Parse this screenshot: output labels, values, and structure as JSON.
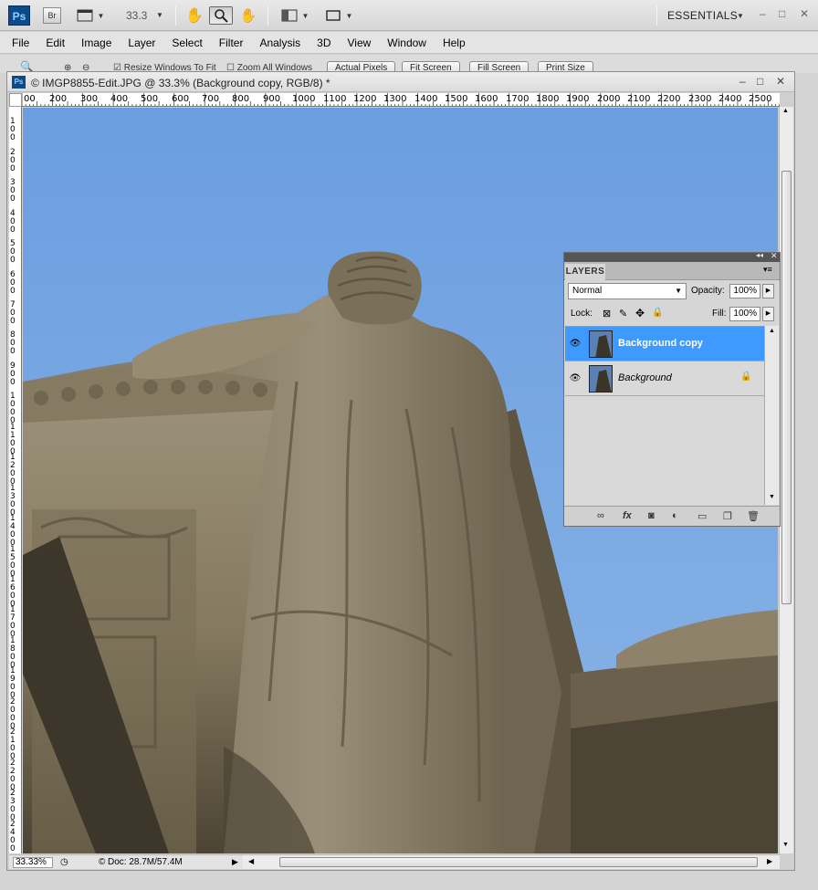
{
  "app": {
    "logo": "Ps",
    "bridge": "Br",
    "zoom": "33.3",
    "workspace": "ESSENTIALS"
  },
  "menu": [
    "File",
    "Edit",
    "Image",
    "Layer",
    "Select",
    "Filter",
    "Analysis",
    "3D",
    "View",
    "Window",
    "Help"
  ],
  "options": {
    "resize_windows": "Resize Windows To Fit",
    "zoom_all": "Zoom All Windows",
    "actual_pixels": "Actual Pixels",
    "fit_screen": "Fit Screen",
    "fill_screen": "Fill Screen",
    "print_size": "Print Size"
  },
  "document": {
    "title": "© IMGP8855-Edit.JPG @ 33.3% (Background copy, RGB/8) *",
    "ruler_top": [
      "00",
      "200",
      "300",
      "400",
      "500",
      "600",
      "700",
      "800",
      "900",
      "1000",
      "1100",
      "1200",
      "1300",
      "1400",
      "1500",
      "1600",
      "1700",
      "1800",
      "1900",
      "2000",
      "2100",
      "2200",
      "2300",
      "2400",
      "2500"
    ],
    "ruler_left": [
      "1 0 0",
      "2 0 0",
      "3 0 0",
      "4 0 0",
      "5 0 0",
      "6 0 0",
      "7 0 0",
      "8 0 0",
      "9 0 0",
      "1 0 0 0",
      "1 1 0 0",
      "1 2 0 0",
      "1 3 0 0",
      "1 4 0 0",
      "1 5 0 0",
      "1 6 0 0",
      "1 7 0 0",
      "1 8 0 0",
      "1 9 0 0",
      "2 0 0 0",
      "2 1 0 0",
      "2 2 0 0",
      "2 3 0 0",
      "2 4 0 0"
    ],
    "status_zoom": "33.33%",
    "status_doc": "Doc: 28.7M/57.4M"
  },
  "layers_panel": {
    "tab": "LAYERS",
    "blend_mode": "Normal",
    "opacity_label": "Opacity:",
    "opacity": "100%",
    "lock_label": "Lock:",
    "fill_label": "Fill:",
    "fill": "100%",
    "layers": [
      {
        "name": "Background copy",
        "selected": true
      },
      {
        "name": "Background",
        "selected": false
      }
    ],
    "footer_fx": "fx"
  },
  "colors": {
    "sky": "#7aa6de",
    "selection": "#3f9aff",
    "stone": "#8c7f63"
  }
}
